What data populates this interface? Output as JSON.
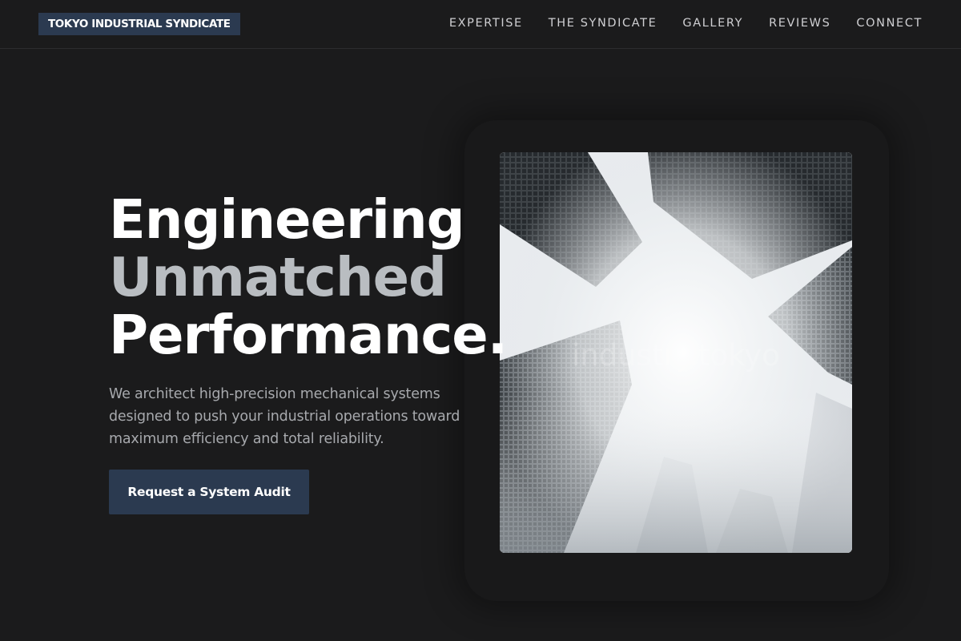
{
  "header": {
    "brand": "TOKYO INDUSTRIAL SYNDICATE",
    "nav": [
      "EXPERTISE",
      "THE SYNDICATE",
      "GALLERY",
      "REVIEWS",
      "CONNECT"
    ]
  },
  "hero": {
    "headline": [
      "Engineering",
      "Unmatched",
      "Performance."
    ],
    "lede": "We architect high-precision mechanical systems designed to push your industrial operations toward maximum efficiency and total reliability.",
    "cta_label": "Request a System Audit",
    "image_watermark": "industry.tokyo"
  },
  "colors": {
    "background": "#1b1b1c",
    "accent": "#2b3a50",
    "headline_muted": "#b9bdc1",
    "body_text": "#a7a9ad"
  }
}
